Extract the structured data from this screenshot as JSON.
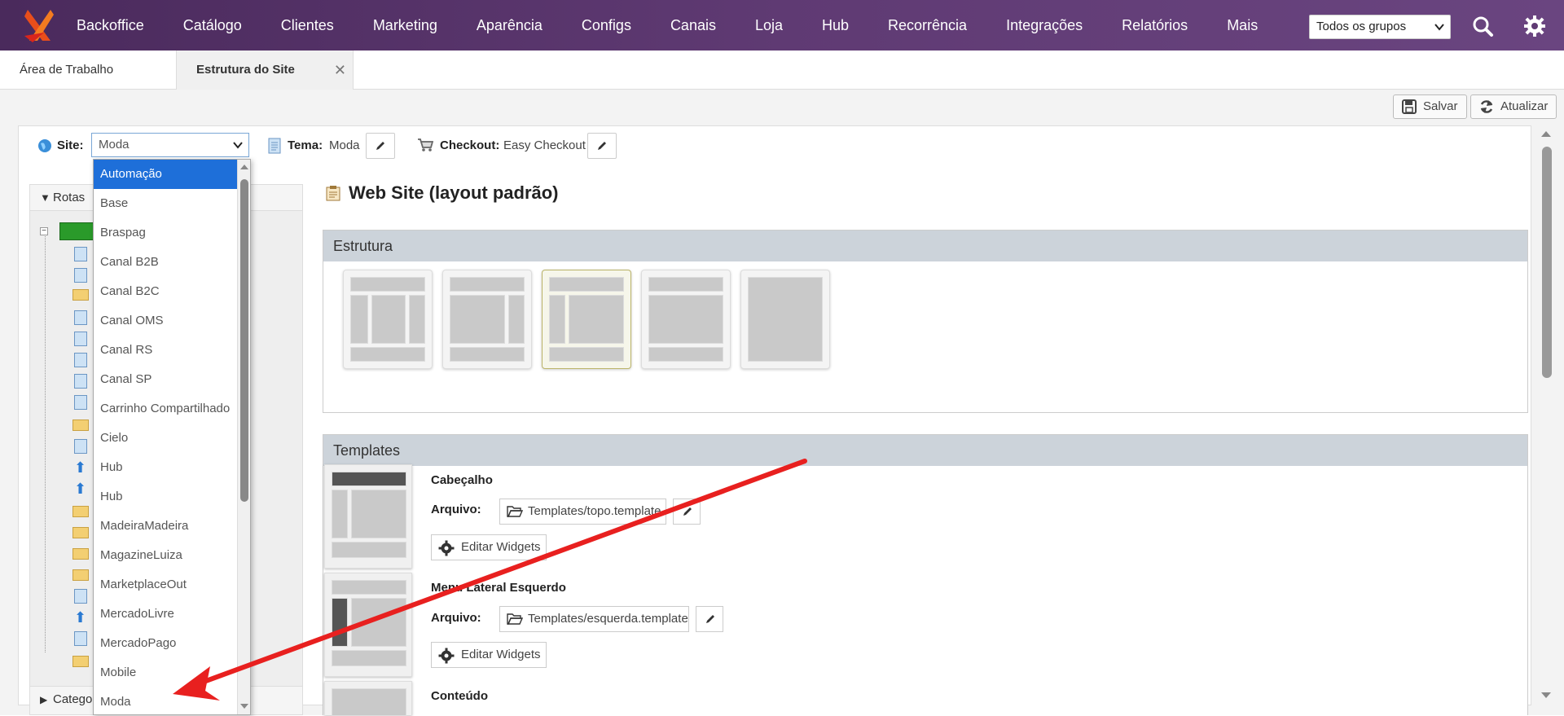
{
  "nav": {
    "items": [
      "Backoffice",
      "Catálogo",
      "Clientes",
      "Marketing",
      "Aparência",
      "Configs",
      "Canais",
      "Loja",
      "Hub",
      "Recorrência",
      "Integrações",
      "Relatórios",
      "Mais"
    ],
    "group_select": "Todos os grupos"
  },
  "tabs": [
    {
      "label": "Área de Trabalho"
    },
    {
      "label": "Estrutura do Site"
    }
  ],
  "toolbar": {
    "save": "Salvar",
    "refresh": "Atualizar"
  },
  "site_row": {
    "site_label": "Site:",
    "site_value": "Moda",
    "theme_label": "Tema:",
    "theme_value": "Moda",
    "checkout_label": "Checkout:",
    "checkout_value": "Easy Checkout"
  },
  "left_pane": {
    "routes": "Rotas",
    "categories": "Catego"
  },
  "dropdown": {
    "options": [
      "Automação",
      "Base",
      "Braspag",
      "Canal B2B",
      "Canal B2C",
      "Canal OMS",
      "Canal RS",
      "Canal SP",
      "Carrinho Compartilhado",
      "Cielo",
      "Hub",
      "Hub",
      "MadeiraMadeira",
      "MagazineLuiza",
      "MarketplaceOut",
      "MercadoLivre",
      "MercadoPago",
      "Mobile",
      "Moda"
    ]
  },
  "main": {
    "title": "Web Site (layout padrão)",
    "structure_head": "Estrutura",
    "templates_head": "Templates",
    "templates": [
      {
        "name": "Cabeçalho",
        "file_label": "Arquivo:",
        "file": "Templates/topo.template",
        "widgets": "Editar Widgets"
      },
      {
        "name": "Menu Lateral Esquerdo",
        "file_label": "Arquivo:",
        "file": "Templates/esquerda.template",
        "widgets": "Editar Widgets"
      },
      {
        "name": "Conteúdo"
      }
    ]
  },
  "colors": {
    "nav_bg": "#5f3a73",
    "selected": "#1e6fd9",
    "arrow": "#e8201f"
  }
}
